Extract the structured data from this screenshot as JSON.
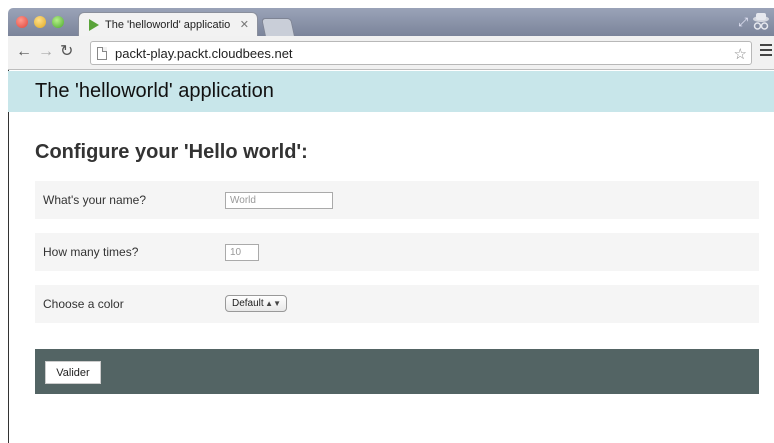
{
  "browser": {
    "tab_title": "The 'helloworld' applicatio",
    "address": "packt-play.packt.cloudbees.net"
  },
  "app": {
    "header_title": "The 'helloworld' application"
  },
  "form": {
    "heading": "Configure your 'Hello world':",
    "name_label": "What's your name?",
    "name_placeholder": "World",
    "times_label": "How many times?",
    "times_placeholder": "10",
    "color_label": "Choose a color",
    "color_selected": "Default",
    "submit_label": "Valider"
  }
}
